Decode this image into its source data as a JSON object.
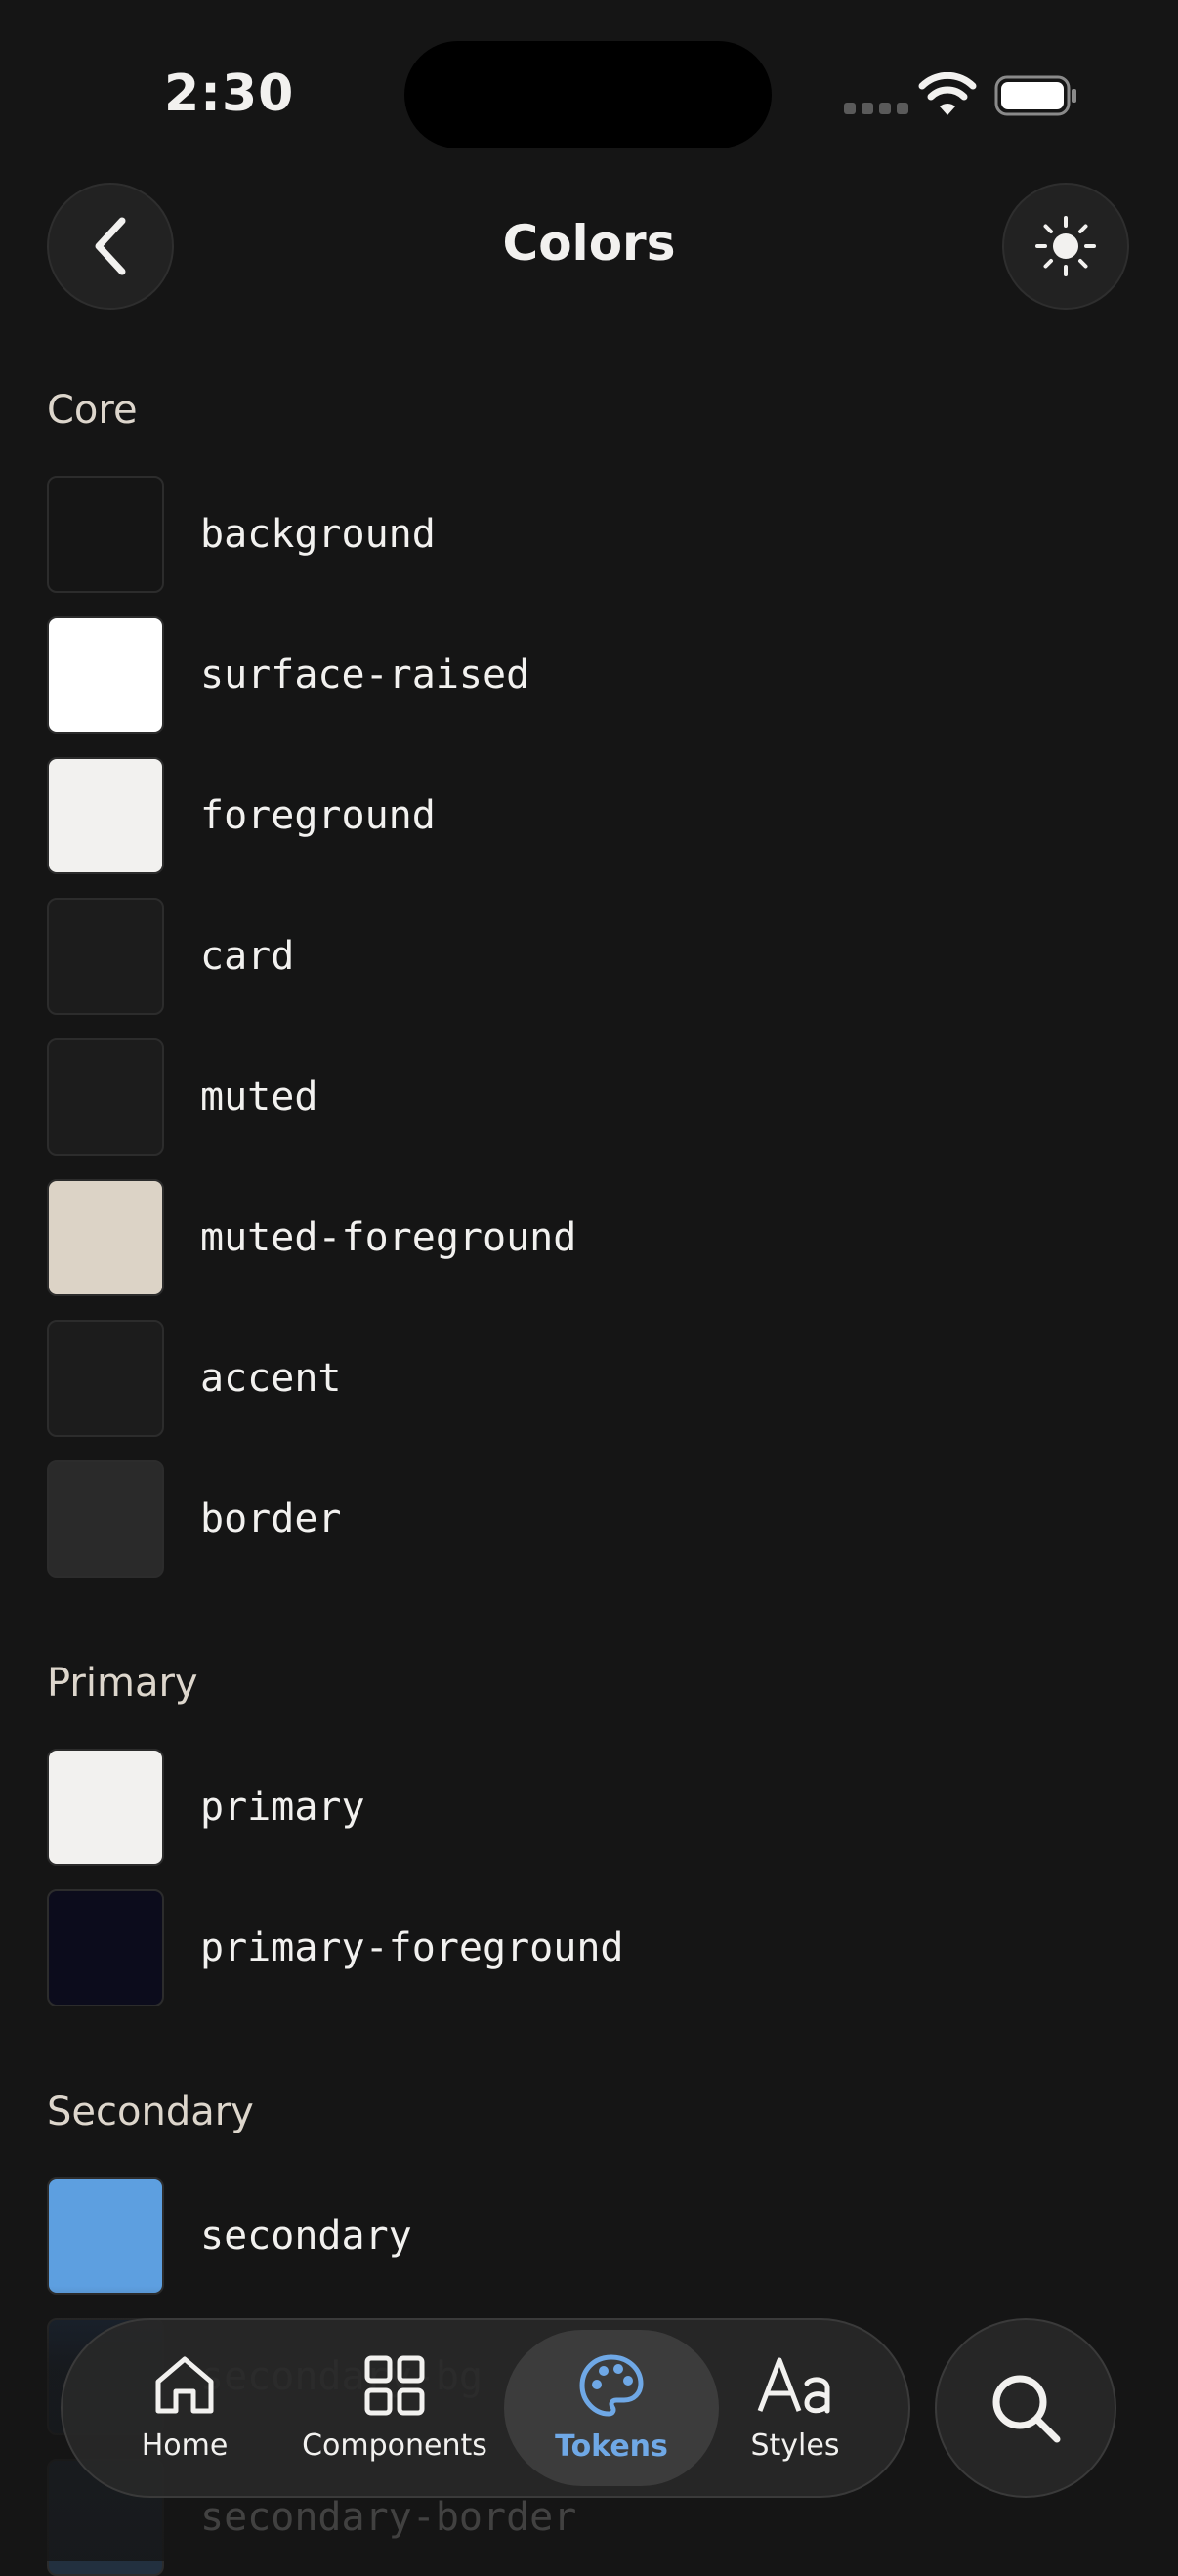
{
  "status": {
    "time": "2:30"
  },
  "header": {
    "title": "Colors"
  },
  "sections": [
    {
      "title": "Core",
      "tokens": [
        {
          "name": "background",
          "color": "#151515"
        },
        {
          "name": "surface-raised",
          "color": "#ffffff"
        },
        {
          "name": "foreground",
          "color": "#f2f1ef"
        },
        {
          "name": "card",
          "color": "#1c1c1c"
        },
        {
          "name": "muted",
          "color": "#1c1c1c"
        },
        {
          "name": "muted-foreground",
          "color": "#dcd3c6"
        },
        {
          "name": "accent",
          "color": "#1c1c1c"
        },
        {
          "name": "border",
          "color": "#2a2a2a"
        }
      ]
    },
    {
      "title": "Primary",
      "tokens": [
        {
          "name": "primary",
          "color": "#f2f1ef"
        },
        {
          "name": "primary-foreground",
          "color": "#0c0c1c"
        }
      ]
    },
    {
      "title": "Secondary",
      "tokens": [
        {
          "name": "secondary",
          "color": "#5d9fe0"
        },
        {
          "name": "secondary-bg",
          "color": "#1b2533"
        },
        {
          "name": "secondary-border",
          "color": "#22303f"
        }
      ]
    }
  ],
  "tabs": {
    "home": "Home",
    "components": "Components",
    "tokens": "Tokens",
    "styles": "Styles",
    "active_color": "#6fa8e6"
  },
  "icons": {
    "back": "chevron-left-icon",
    "theme": "sun-icon",
    "search": "search-icon"
  }
}
